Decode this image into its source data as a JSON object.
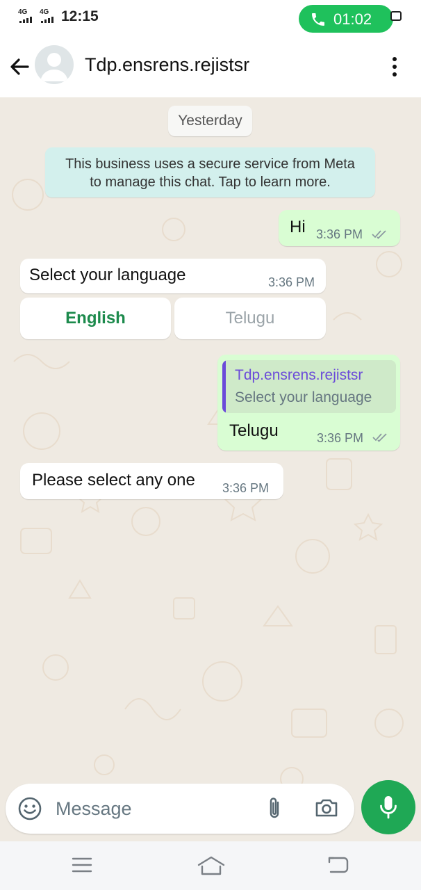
{
  "status_bar": {
    "network_1": "4G",
    "network_2": "4G",
    "time": "12:15",
    "call_timer": "01:02",
    "colors": {
      "call_pill": "#1fc15c"
    }
  },
  "header": {
    "contact_name": "Tdp.ensrens.rejistsr",
    "icons": [
      "back-arrow-icon",
      "default-avatar-icon",
      "more-vertical-icon"
    ]
  },
  "chat": {
    "date_chip": "Yesterday",
    "system_notice_line1": "This business uses a secure service from Meta",
    "system_notice_line2": "to manage this chat. Tap to learn more.",
    "messages": [
      {
        "direction": "outgoing",
        "text": "Hi",
        "time": "3:36 PM",
        "status": "read-double-tick"
      },
      {
        "direction": "incoming",
        "text": "Select your language",
        "time": "3:36 PM"
      },
      {
        "direction": "outgoing",
        "quoted_name": "Tdp.ensrens.rejistsr",
        "quoted_text": "Select your language",
        "text": "Telugu",
        "time": "3:36 PM",
        "status": "read-double-tick"
      },
      {
        "direction": "incoming",
        "text": "Please select any one",
        "time": "3:36 PM"
      }
    ],
    "reply_buttons": [
      {
        "label": "English",
        "state": "active",
        "color": "#1c8a4c"
      },
      {
        "label": "Telugu",
        "state": "disabled",
        "color": "#9aa3a8"
      }
    ],
    "colors": {
      "outgoing_bubble": "#d9fdd3",
      "incoming_bubble": "#ffffff",
      "quote_accent": "#6b4bd9",
      "background": "#efeae2"
    }
  },
  "composer": {
    "placeholder": "Message",
    "icons": [
      "emoji-icon",
      "paperclip-icon",
      "camera-icon",
      "microphone-icon"
    ],
    "colors": {
      "mic_button": "#1fa855"
    }
  },
  "navbar": {
    "icons": [
      "menu-icon",
      "home-icon",
      "back-icon"
    ]
  }
}
